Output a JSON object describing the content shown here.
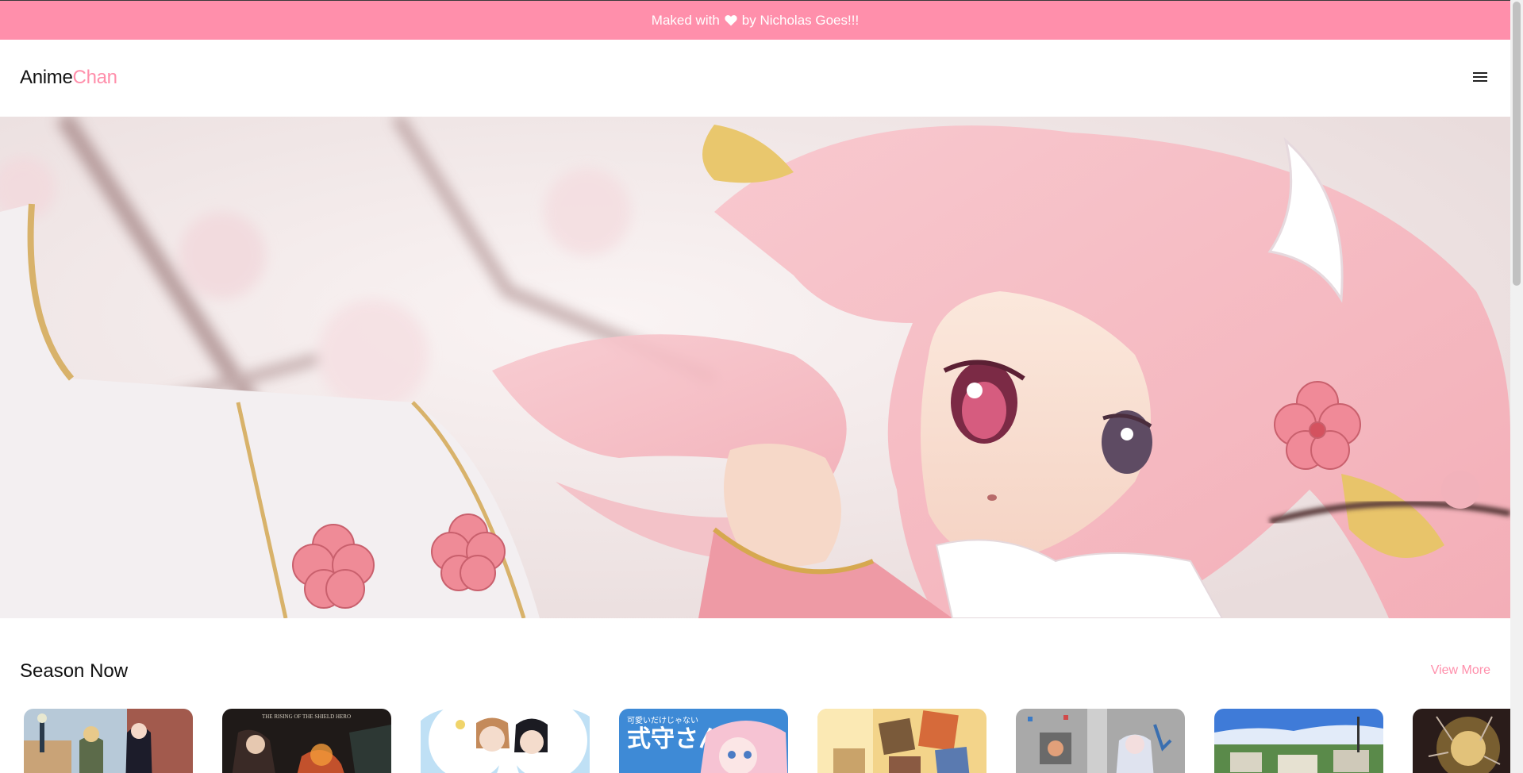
{
  "banner": {
    "prefix": "Maked with",
    "suffix": "by  Nicholas Goes!!!",
    "heart_icon": "heart-icon"
  },
  "header": {
    "logo_main": "Anime",
    "logo_accent": "Chan",
    "menu_icon": "hamburger-menu-icon"
  },
  "hero": {
    "image": "anime-girl-cherry-blossom-banner"
  },
  "season": {
    "title": "Season Now",
    "view_more": "View More",
    "cards": [
      {
        "image": "spy-family-poster"
      },
      {
        "image": "rising-of-the-shield-hero-poster"
      },
      {
        "image": "kaguya-sama-poster"
      },
      {
        "image": "shikimori-san-poster"
      },
      {
        "image": "anime-poster-5"
      },
      {
        "image": "anime-poster-6"
      },
      {
        "image": "anime-poster-7"
      },
      {
        "image": "anime-poster-8"
      }
    ]
  },
  "colors": {
    "accent": "#ff8fab",
    "text": "#111111",
    "background": "#ffffff"
  }
}
